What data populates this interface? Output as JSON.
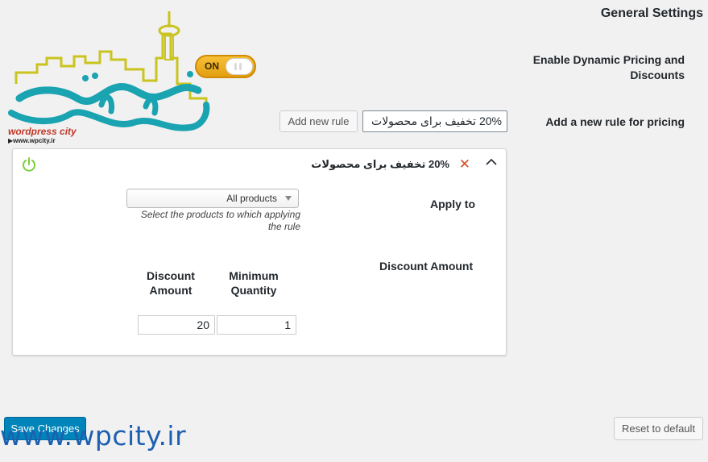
{
  "header": {
    "title": "General Settings",
    "enable_label": "Enable Dynamic Pricing and Discounts",
    "toggle_text": "ON",
    "add_rule_label": "Add a new rule for pricing",
    "add_rule_button": "Add new rule",
    "add_rule_value": "20% تخفیف برای محصولات"
  },
  "rule": {
    "title": "20% تخفیف برای محصولات",
    "apply_to_label": "Apply to",
    "apply_to_selected": "All products",
    "apply_to_hint": "Select the products to which applying the rule",
    "discount_amount_label": "Discount Amount",
    "columns": [
      "Discount Amount",
      "Minimum Quantity"
    ],
    "rows": [
      {
        "discount": "20",
        "minimum": "1"
      }
    ]
  },
  "footer": {
    "save_label": "Save Changes",
    "reset_label": "Reset to default"
  },
  "watermark": {
    "url_text": "www.wpcity.ir",
    "logo_brand": "wordpress city",
    "logo_url": "▶www.wpcity.ir"
  },
  "colors": {
    "accent": "#0085ba",
    "toggle": "#f0b020",
    "delete": "#d54e21",
    "power": "#7ad03a",
    "logo_teal": "#1aa3b0",
    "logo_gold": "#c9c41e"
  }
}
